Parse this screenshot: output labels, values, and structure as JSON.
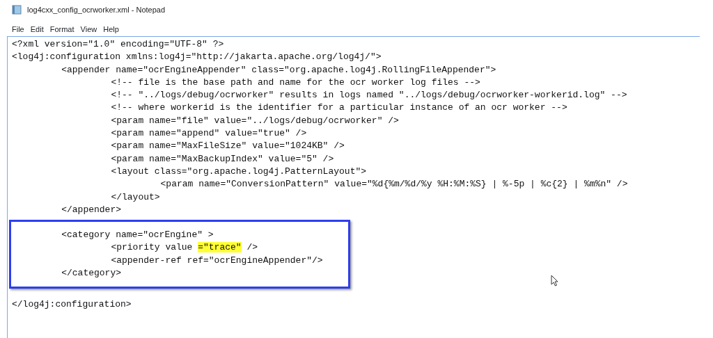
{
  "window": {
    "title": "log4cxx_config_ocrworker.xml - Notepad"
  },
  "menu": [
    "File",
    "Edit",
    "Format",
    "View",
    "Help"
  ],
  "editor": {
    "lines": [
      {
        "text": "<?xml version=\"1.0\" encoding=\"UTF-8\" ?>"
      },
      {
        "text": "<log4j:configuration xmlns:log4j=\"http://jakarta.apache.org/log4j/\">",
        "closing": "</log4j:configuration>",
        "children": [
          {
            "text": "<appender name=\"ocrEngineAppender\" class=\"org.apache.log4j.RollingFileAppender\">",
            "closing": "</appender>",
            "children": [
              {
                "text": "<!-- file is the base path and name for the ocr worker log files -->"
              },
              {
                "text": "<!-- \"../logs/debug/ocrworker\" results in logs named \"../logs/debug/ocrworker-workerid.log\" -->"
              },
              {
                "text": "<!-- where workerid is the identifier for a particular instance of an ocr worker -->"
              },
              {
                "text": "<param name=\"file\" value=\"../logs/debug/ocrworker\" />"
              },
              {
                "text": "<param name=\"append\" value=\"true\" />"
              },
              {
                "text": "<param name=\"MaxFileSize\" value=\"1024KB\" />"
              },
              {
                "text": "<param name=\"MaxBackupIndex\" value=\"5\" />"
              },
              {
                "text": "<layout class=\"org.apache.log4j.PatternLayout\">",
                "closing": "</layout>",
                "children": [
                  {
                    "text": "<param name=\"ConversionPattern\" value=\"%d{%m/%d/%y %H:%M:%S} | %-5p | %c{2} | %m%n\" />"
                  }
                ]
              }
            ]
          },
          {
            "text": "<category name=\"ocrEngine\" >",
            "closing": "</category>",
            "boxed": true,
            "children": [
              {
                "text": "<priority value ",
                "highlight": "=\"trace\"",
                "after": " />"
              },
              {
                "text": "<appender-ref ref=\"ocrEngineAppender\"/>"
              }
            ]
          }
        ]
      }
    ]
  }
}
